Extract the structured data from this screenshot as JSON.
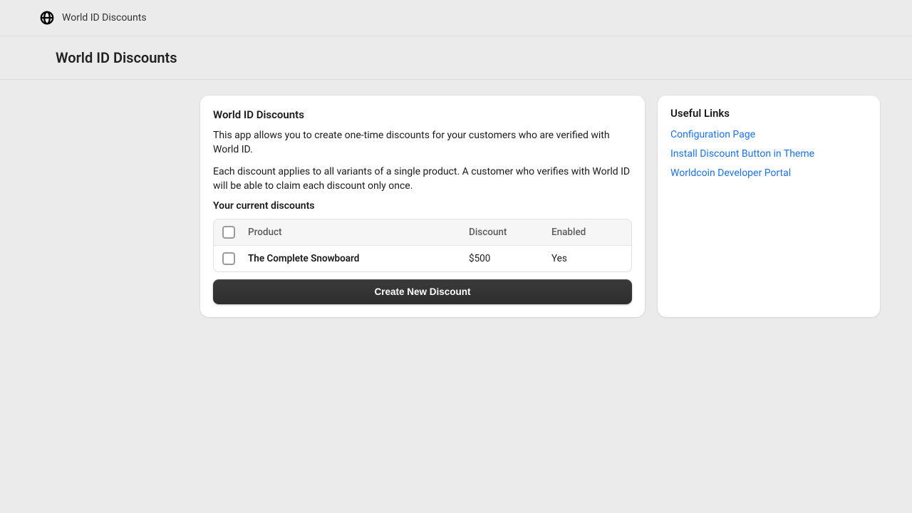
{
  "topbar": {
    "app_name": "World ID Discounts"
  },
  "titlebar": {
    "heading": "World ID Discounts"
  },
  "main": {
    "heading": "World ID Discounts",
    "intro_1": "This app allows you to create one-time discounts for your customers who are verified with World ID.",
    "intro_2": "Each discount applies to all variants of a single product. A customer who verifies with World ID will be able to claim each discount only once.",
    "subheading": "Your current discounts",
    "table": {
      "headers": {
        "product": "Product",
        "discount": "Discount",
        "enabled": "Enabled"
      },
      "rows": [
        {
          "product": "The Complete Snowboard",
          "discount": "$500",
          "enabled": "Yes"
        }
      ]
    },
    "create_button": "Create New Discount"
  },
  "sidebar": {
    "heading": "Useful Links",
    "links": [
      {
        "label": "Configuration Page"
      },
      {
        "label": "Install Discount Button in Theme"
      },
      {
        "label": "Worldcoin Developer Portal"
      }
    ]
  }
}
